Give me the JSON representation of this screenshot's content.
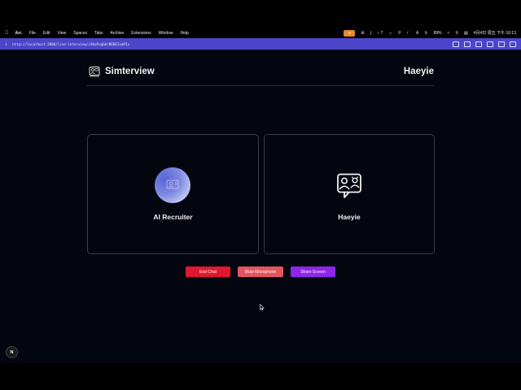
{
  "menubar": {
    "app_name": "Arc",
    "menus": [
      "File",
      "Edit",
      "View",
      "Spaces",
      "Tabs",
      "Archive",
      "Extensions",
      "Window",
      "Help"
    ],
    "badge_count": "7",
    "battery": "89%",
    "datetime": "4月4日 周五 下午 10:13",
    "icons": [
      "apple-icon",
      "recording-icon",
      "gear-icon",
      "notification-icon",
      "wifi-icon",
      "search-icon",
      "control-center-icon"
    ]
  },
  "browser": {
    "url": "http://localhost:3000/live-interview/i8kaPuqbHrNRBEIxmPIx"
  },
  "header": {
    "app_title": "Simterview",
    "user_name": "Haeyie"
  },
  "cards": {
    "ai_label": "AI Recruiter",
    "user_label": "Haeyie"
  },
  "controls": {
    "end_chat": "End Chat",
    "mute_microphone": "Mute Microphone",
    "share_screen": "Share Screen"
  },
  "dev": {
    "badge": "N"
  },
  "colors": {
    "app_bg": "#03050f",
    "url_bar": "#4b46c9",
    "end_chat": "#e0182f",
    "mute": "#e2555e",
    "share": "#8e26ea"
  }
}
